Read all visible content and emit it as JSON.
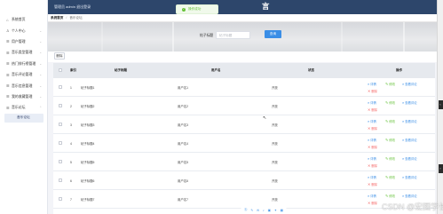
{
  "header": {
    "title": "管理员 admin  退出登录",
    "page_big_title": "言"
  },
  "toast": {
    "icon": "success-check-icon",
    "text": "操作成功"
  },
  "sidebar": {
    "items": [
      {
        "label": "系统首页",
        "icon": "home-icon",
        "has_chevron": false
      },
      {
        "label": "个人中心",
        "icon": "user-icon",
        "has_chevron": true
      },
      {
        "label": "用户管理",
        "icon": "users-icon",
        "has_chevron": true
      },
      {
        "label": "音乐类型管理",
        "icon": "list-icon",
        "has_chevron": true
      },
      {
        "label": "热门排行榜管理",
        "icon": "chart-icon",
        "has_chevron": true
      },
      {
        "label": "音乐评论管理",
        "icon": "comment-icon",
        "has_chevron": true
      },
      {
        "label": "音乐信息管理",
        "icon": "music-icon",
        "has_chevron": true
      },
      {
        "label": "我的收藏管理",
        "icon": "star-icon",
        "has_chevron": true
      },
      {
        "label": "音乐论坛",
        "icon": "forum-icon",
        "has_chevron": true
      }
    ],
    "sub_item": "音乐论坛"
  },
  "breadcrumb": {
    "home": "系统首页",
    "separator": "/",
    "current": "音乐论坛"
  },
  "search": {
    "label": "帖子标题",
    "placeholder": "帖子标题",
    "button": "查询"
  },
  "toolbar": {
    "delete_label": "删除"
  },
  "table": {
    "headers": {
      "index": "索引",
      "title": "帖子标题",
      "user": "用户名",
      "status": "状态",
      "actions": "操作"
    },
    "rows": [
      {
        "index": "1",
        "title": "帖子标题1",
        "user": "用户名1",
        "status": "开放"
      },
      {
        "index": "2",
        "title": "帖子标题2",
        "user": "用户名2",
        "status": "开放"
      },
      {
        "index": "3",
        "title": "帖子标题3",
        "user": "用户名3",
        "status": "开放"
      },
      {
        "index": "4",
        "title": "帖子标题4",
        "user": "用户名4",
        "status": "开放"
      },
      {
        "index": "5",
        "title": "帖子标题5",
        "user": "用户名5",
        "status": "开放"
      },
      {
        "index": "6",
        "title": "帖子标题6",
        "user": "用户名6",
        "status": "开放"
      },
      {
        "index": "7",
        "title": "帖子标题7",
        "user": "用户名7",
        "status": "开放"
      }
    ],
    "actions": {
      "detail": "详情",
      "edit": "修改",
      "view_comments": "查看评论",
      "delete": "删除"
    }
  },
  "watermark": "CSDN @宏图学长",
  "colors": {
    "topbar": "#2d466b",
    "primary": "#3a8ee6",
    "success": "#67c23a",
    "danger": "#f56c6c"
  }
}
